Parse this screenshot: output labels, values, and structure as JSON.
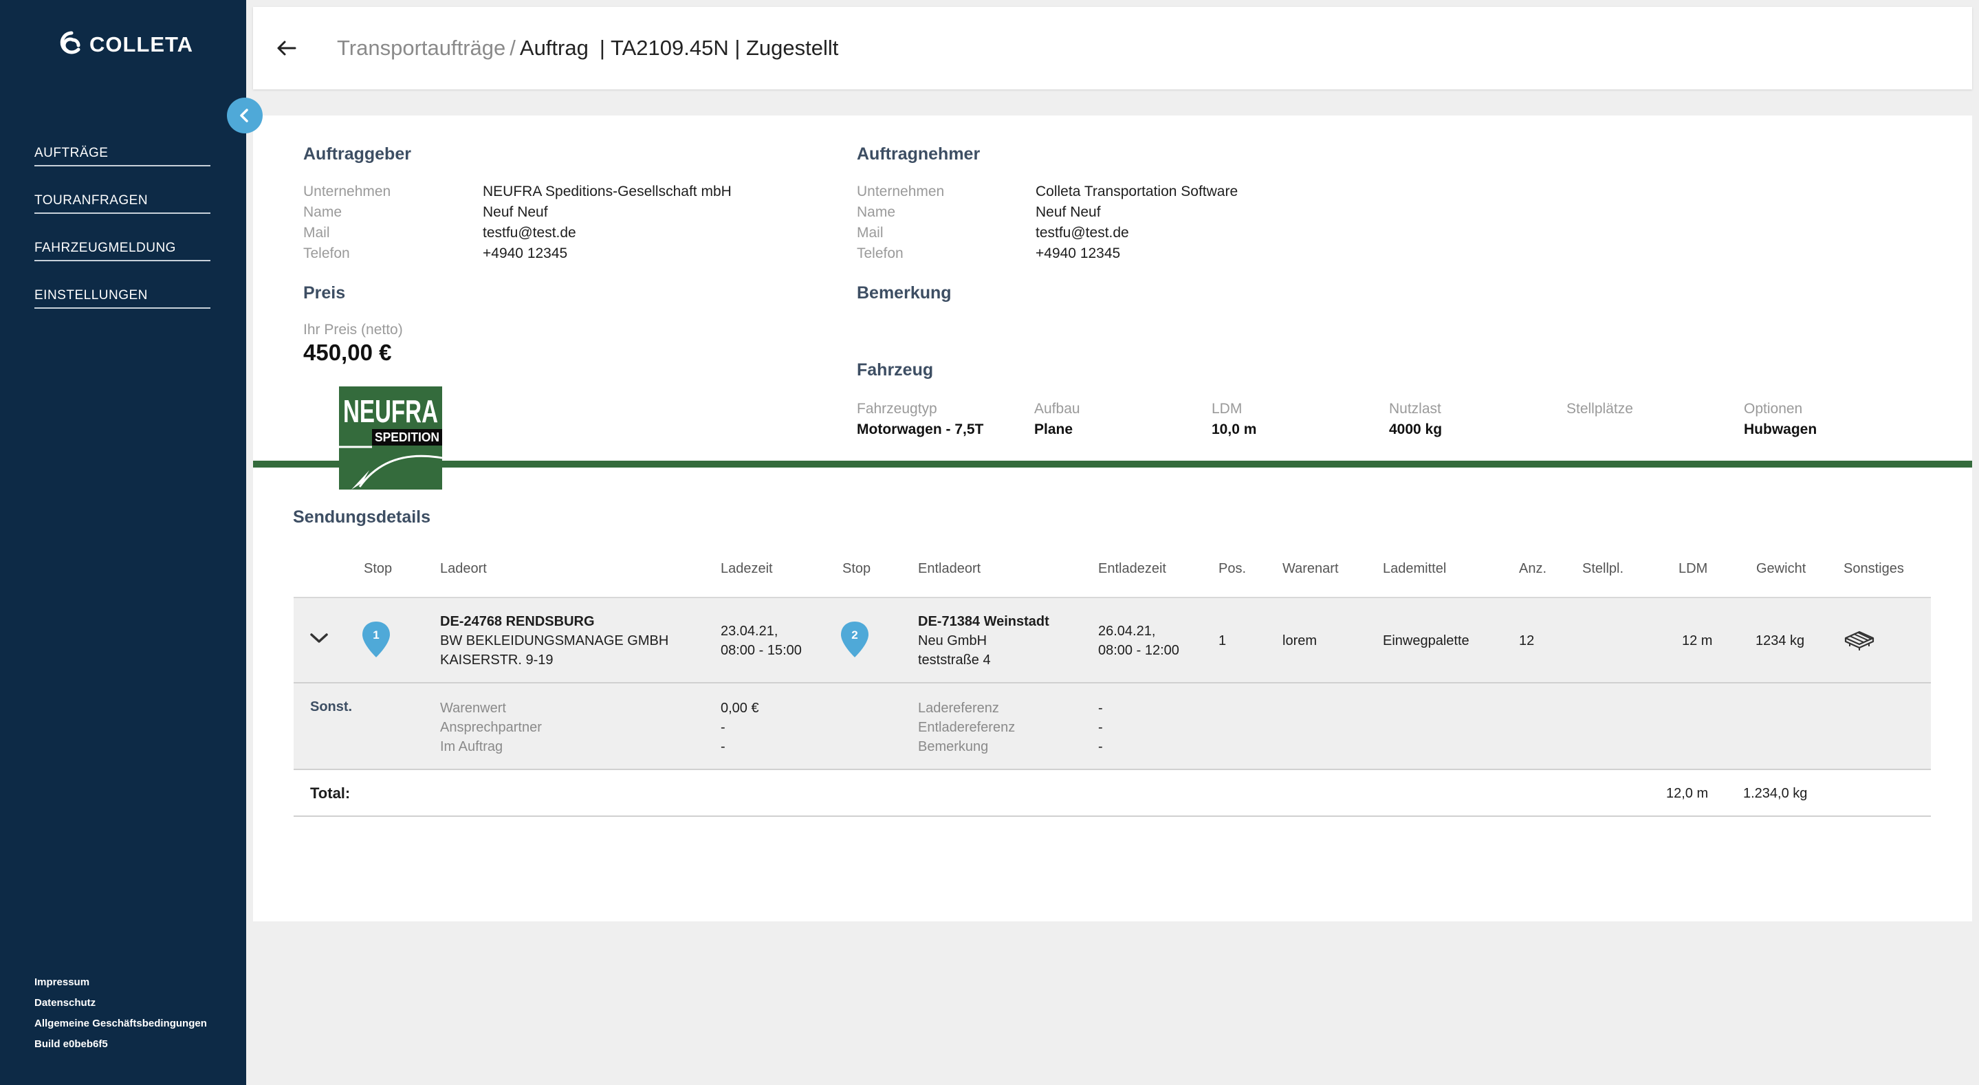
{
  "sidebar": {
    "logo_text": "COLLETA",
    "nav": [
      "AUFTRÄGE",
      "TOURANFRAGEN",
      "FAHRZEUGMELDUNG",
      "EINSTELLUNGEN"
    ],
    "footer": [
      "Impressum",
      "Datenschutz",
      "Allgemeine Geschäftsbedingungen",
      "Build e0beb6f5"
    ]
  },
  "header": {
    "crumb_parent": "Transportaufträge",
    "crumb_sep": "/",
    "crumb_current": "Auftrag",
    "order_info": "| TA2109.45N | Zugestellt"
  },
  "client": {
    "title": "Auftraggeber",
    "labels": [
      "Unternehmen",
      "Name",
      "Mail",
      "Telefon"
    ],
    "values": [
      "NEUFRA Speditions-Gesellschaft mbH",
      "Neuf Neuf",
      "testfu@test.de",
      "+4940 12345"
    ]
  },
  "contractor": {
    "title": "Auftragnehmer",
    "labels": [
      "Unternehmen",
      "Name",
      "Mail",
      "Telefon"
    ],
    "values": [
      "Colleta Transportation Software",
      "Neuf Neuf",
      "testfu@test.de",
      "+4940 12345"
    ]
  },
  "price": {
    "title": "Preis",
    "label": "Ihr Preis (netto)",
    "value": "450,00 €"
  },
  "remark": {
    "title": "Bemerkung"
  },
  "vehicle": {
    "title": "Fahrzeug",
    "columns": [
      {
        "label": "Fahrzeugtyp",
        "value": "Motorwagen - 7,5T"
      },
      {
        "label": "Aufbau",
        "value": "Plane"
      },
      {
        "label": "LDM",
        "value": "10,0 m"
      },
      {
        "label": "Nutzlast",
        "value": "4000 kg"
      },
      {
        "label": "Stellplätze",
        "value": ""
      },
      {
        "label": "Optionen",
        "value": "Hubwagen"
      }
    ]
  },
  "neufra_logo": {
    "line1": "NEUFRA",
    "line2": "SPEDITION"
  },
  "shipment": {
    "title": "Sendungsdetails",
    "headers": [
      "Stop",
      "Ladeort",
      "Ladezeit",
      "Stop",
      "Entladeort",
      "Entladezeit",
      "Pos.",
      "Warenart",
      "Lademittel",
      "Anz.",
      "Stellpl.",
      "LDM",
      "Gewicht",
      "Sonstiges"
    ],
    "row": {
      "stop_load": "1",
      "load_place": [
        "DE-24768 RENDSBURG",
        "BW BEKLEIDUNGSMANAGE GMBH",
        "KAISERSTR. 9-19"
      ],
      "load_time": [
        "23.04.21,",
        "08:00 - 15:00"
      ],
      "stop_unload": "2",
      "unload_place": [
        "DE-71384 Weinstadt",
        "Neu GmbH",
        "teststraße 4"
      ],
      "unload_time": [
        "26.04.21,",
        "08:00 - 12:00"
      ],
      "pos": "1",
      "goods": "lorem",
      "loading_equipment": "Einwegpalette",
      "count": "12",
      "spaces": "",
      "ldm": "12 m",
      "weight": "1234 kg"
    },
    "extra": {
      "title": "Sonst.",
      "left_labels": [
        "Warenwert",
        "Ansprechpartner",
        "Im Auftrag"
      ],
      "left_values": [
        "0,00 €",
        "-",
        "-"
      ],
      "right_labels": [
        "Ladereferenz",
        "Entladereferenz",
        "Bemerkung"
      ],
      "right_values": [
        "-",
        "-",
        "-"
      ]
    },
    "total": {
      "label": "Total:",
      "ldm": "12,0 m",
      "weight": "1.234,0 kg"
    }
  },
  "colors": {
    "sidebar": "#0d2a46",
    "accent": "#4fa9d8",
    "green": "#346b3c"
  }
}
